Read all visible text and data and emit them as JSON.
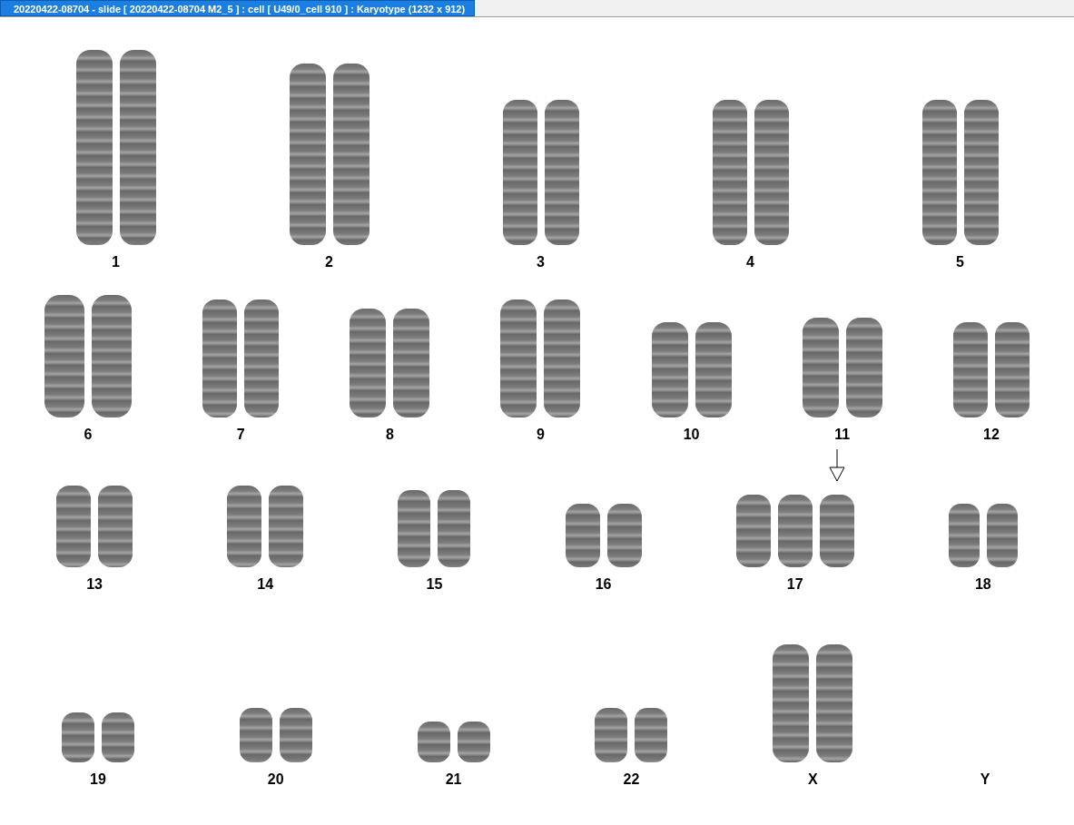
{
  "window": {
    "title": "20220422-08704 - slide [ 20220422-08704 M2_5 ] : cell [ U49/0_cell 910 ] : Karyotype  (1232 x 912)"
  },
  "rows": [
    {
      "groups": [
        {
          "label": "1",
          "homologs": [
            {
              "kind": "plain"
            },
            {
              "kind": "plain"
            }
          ]
        },
        {
          "label": "2",
          "homologs": [
            {
              "kind": "plain"
            },
            {
              "kind": "plain"
            }
          ]
        },
        {
          "label": "3",
          "homologs": [
            {
              "kind": "plain"
            },
            {
              "kind": "plain"
            }
          ]
        },
        {
          "label": "4",
          "homologs": [
            {
              "kind": "plain"
            },
            {
              "kind": "plain"
            }
          ]
        },
        {
          "label": "5",
          "homologs": [
            {
              "kind": "plain"
            },
            {
              "kind": "plain"
            }
          ]
        }
      ]
    },
    {
      "groups": [
        {
          "label": "6",
          "homologs": [
            {
              "kind": "plain"
            },
            {
              "kind": "plain"
            }
          ]
        },
        {
          "label": "7",
          "homologs": [
            {
              "kind": "plain"
            },
            {
              "kind": "plain"
            }
          ]
        },
        {
          "label": "8",
          "homologs": [
            {
              "kind": "plain"
            },
            {
              "kind": "plain"
            }
          ]
        },
        {
          "label": "9",
          "homologs": [
            {
              "kind": "plain"
            },
            {
              "kind": "plain"
            }
          ]
        },
        {
          "label": "10",
          "homologs": [
            {
              "kind": "plain"
            },
            {
              "kind": "plain"
            }
          ]
        },
        {
          "label": "11",
          "homologs": [
            {
              "kind": "plain"
            },
            {
              "kind": "plain"
            }
          ]
        },
        {
          "label": "12",
          "homologs": [
            {
              "kind": "plain"
            },
            {
              "kind": "plain"
            }
          ]
        }
      ]
    },
    {
      "groups": [
        {
          "label": "13",
          "homologs": [
            {
              "kind": "plain"
            },
            {
              "kind": "plain"
            }
          ]
        },
        {
          "label": "14",
          "homologs": [
            {
              "kind": "plain"
            },
            {
              "kind": "plain"
            }
          ]
        },
        {
          "label": "15",
          "homologs": [
            {
              "kind": "plain"
            },
            {
              "kind": "plain"
            }
          ]
        },
        {
          "label": "16",
          "homologs": [
            {
              "kind": "plain"
            },
            {
              "kind": "plain"
            }
          ]
        },
        {
          "label": "17",
          "homologs": [
            {
              "kind": "plain"
            },
            {
              "kind": "plain"
            },
            {
              "kind": "marked"
            }
          ]
        },
        {
          "label": "18",
          "homologs": [
            {
              "kind": "plain"
            },
            {
              "kind": "plain"
            }
          ]
        }
      ]
    },
    {
      "groups": [
        {
          "label": "19",
          "homologs": [
            {
              "kind": "plain"
            },
            {
              "kind": "plain"
            }
          ]
        },
        {
          "label": "20",
          "homologs": [
            {
              "kind": "plain"
            },
            {
              "kind": "plain"
            }
          ]
        },
        {
          "label": "21",
          "homologs": [
            {
              "kind": "plain"
            },
            {
              "kind": "plain"
            }
          ]
        },
        {
          "label": "22",
          "homologs": [
            {
              "kind": "plain"
            },
            {
              "kind": "plain"
            }
          ]
        },
        {
          "label": "X",
          "homologs": [
            {
              "kind": "plain"
            },
            {
              "kind": "plain"
            }
          ]
        },
        {
          "label": "Y"
        }
      ]
    }
  ]
}
